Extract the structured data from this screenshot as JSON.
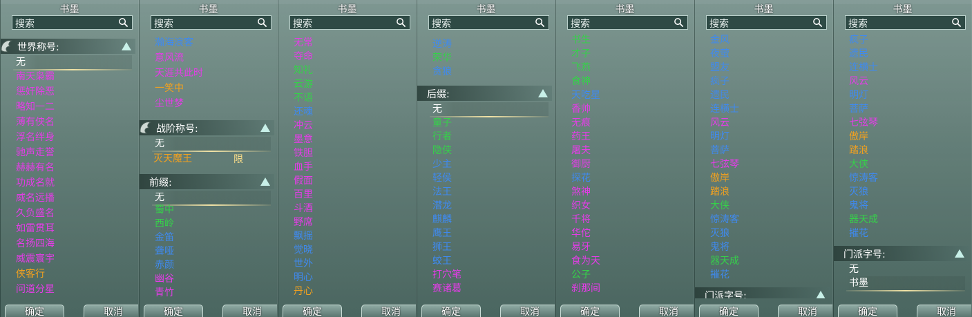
{
  "title": "书墨",
  "search_placeholder": "搜索",
  "buttons": {
    "ok": "确定",
    "cancel": "取消"
  },
  "colors": {
    "blue": "#3f8af0",
    "magenta": "#e53ce8",
    "green": "#36d04a",
    "orange": "#f0a020"
  },
  "col1": {
    "section_world": "世界称号:",
    "world_selected": "无",
    "items": [
      {
        "t": "南天枭霸",
        "c": "mag"
      },
      {
        "t": "惩奸除恶",
        "c": "mag"
      },
      {
        "t": "略知一二",
        "c": "mag"
      },
      {
        "t": "薄有侠名",
        "c": "mag"
      },
      {
        "t": "浮名绊身",
        "c": "mag"
      },
      {
        "t": "驰声走誉",
        "c": "mag"
      },
      {
        "t": "赫赫有名",
        "c": "mag"
      },
      {
        "t": "功成名就",
        "c": "mag"
      },
      {
        "t": "威名远播",
        "c": "mag"
      },
      {
        "t": "久负盛名",
        "c": "mag"
      },
      {
        "t": "如雷贯耳",
        "c": "mag"
      },
      {
        "t": "名扬四海",
        "c": "mag"
      },
      {
        "t": "威震寰宇",
        "c": "mag"
      },
      {
        "t": "侠客行",
        "c": "orange"
      },
      {
        "t": "问道分星",
        "c": "mag"
      }
    ]
  },
  "col2": {
    "top_items": [
      {
        "t": "瀚海浪客",
        "c": "blue"
      },
      {
        "t": "意风流",
        "c": "mag"
      },
      {
        "t": "天涯共此时",
        "c": "mag"
      },
      {
        "t": "一笑中",
        "c": "orange"
      },
      {
        "t": "尘世梦",
        "c": "mag"
      }
    ],
    "section_rank": "战阶称号:",
    "rank_selected": "无",
    "rank_item": "灭天魔王",
    "rank_limit": "限",
    "section_prefix": "前缀:",
    "prefix_selected": "无",
    "prefix_items": [
      {
        "t": "蜀中",
        "c": "green"
      },
      {
        "t": "西岭",
        "c": "green"
      },
      {
        "t": "金笛",
        "c": "blue"
      },
      {
        "t": "聋哑",
        "c": "blue"
      },
      {
        "t": "赤颜",
        "c": "blue"
      },
      {
        "t": "幽谷",
        "c": "mag"
      },
      {
        "t": "青竹",
        "c": "mag"
      }
    ]
  },
  "col3": {
    "items": [
      {
        "t": "无常",
        "c": "mag"
      },
      {
        "t": "夺命",
        "c": "mag"
      },
      {
        "t": "知礼",
        "c": "green"
      },
      {
        "t": "云游",
        "c": "green"
      },
      {
        "t": "不语",
        "c": "green"
      },
      {
        "t": "还魂",
        "c": "blue"
      },
      {
        "t": "冲云",
        "c": "mag"
      },
      {
        "t": "墨意",
        "c": "mag"
      },
      {
        "t": "铁胆",
        "c": "mag"
      },
      {
        "t": "血手",
        "c": "mag"
      },
      {
        "t": "假面",
        "c": "mag"
      },
      {
        "t": "百里",
        "c": "mag"
      },
      {
        "t": "斗酒",
        "c": "mag"
      },
      {
        "t": "野席",
        "c": "mag"
      },
      {
        "t": "飘摇",
        "c": "blue"
      },
      {
        "t": "觉晓",
        "c": "blue"
      },
      {
        "t": "世外",
        "c": "blue"
      },
      {
        "t": "明心",
        "c": "blue"
      },
      {
        "t": "丹心",
        "c": "orange"
      }
    ]
  },
  "col4": {
    "top_items": [
      {
        "t": "逆涛",
        "c": "blue"
      },
      {
        "t": "荣华",
        "c": "green"
      },
      {
        "t": "贪狼",
        "c": "blue"
      }
    ],
    "section_suffix": "后缀:",
    "suffix_selected": "无",
    "suffix_items": [
      {
        "t": "童子",
        "c": "green"
      },
      {
        "t": "行者",
        "c": "green"
      },
      {
        "t": "隐侠",
        "c": "green"
      },
      {
        "t": "少主",
        "c": "blue"
      },
      {
        "t": "轻侯",
        "c": "blue"
      },
      {
        "t": "法王",
        "c": "blue"
      },
      {
        "t": "潜龙",
        "c": "blue"
      },
      {
        "t": "麒麟",
        "c": "blue"
      },
      {
        "t": "鹰王",
        "c": "blue"
      },
      {
        "t": "狮王",
        "c": "blue"
      },
      {
        "t": "蛟王",
        "c": "blue"
      },
      {
        "t": "打穴笔",
        "c": "mag"
      },
      {
        "t": "赛诸葛",
        "c": "mag"
      }
    ]
  },
  "col5": {
    "items": [
      {
        "t": "书生",
        "c": "green"
      },
      {
        "t": "才子",
        "c": "green"
      },
      {
        "t": "飞燕",
        "c": "green"
      },
      {
        "t": "食神",
        "c": "green"
      },
      {
        "t": "天吃星",
        "c": "blue"
      },
      {
        "t": "香帅",
        "c": "mag"
      },
      {
        "t": "无痕",
        "c": "mag"
      },
      {
        "t": "药王",
        "c": "mag"
      },
      {
        "t": "屠夫",
        "c": "mag"
      },
      {
        "t": "御厨",
        "c": "mag"
      },
      {
        "t": "探花",
        "c": "blue"
      },
      {
        "t": "煞神",
        "c": "mag"
      },
      {
        "t": "织女",
        "c": "mag"
      },
      {
        "t": "千将",
        "c": "mag"
      },
      {
        "t": "华佗",
        "c": "mag"
      },
      {
        "t": "易牙",
        "c": "mag"
      },
      {
        "t": "食为天",
        "c": "mag"
      },
      {
        "t": "公子",
        "c": "green"
      },
      {
        "t": "刹那间",
        "c": "mag"
      }
    ]
  },
  "col6": {
    "items": [
      {
        "t": "金风",
        "c": "blue"
      },
      {
        "t": "夜萤",
        "c": "blue"
      },
      {
        "t": "盟友",
        "c": "blue"
      },
      {
        "t": "疯子",
        "c": "blue"
      },
      {
        "t": "遗民",
        "c": "blue"
      },
      {
        "t": "连横士",
        "c": "blue"
      },
      {
        "t": "风云",
        "c": "mag"
      },
      {
        "t": "明灯",
        "c": "blue"
      },
      {
        "t": "菩萨",
        "c": "blue"
      },
      {
        "t": "七弦琴",
        "c": "mag"
      },
      {
        "t": "傲岸",
        "c": "orange"
      },
      {
        "t": "踏浪",
        "c": "orange"
      },
      {
        "t": "大侠",
        "c": "green"
      },
      {
        "t": "惊涛客",
        "c": "blue"
      },
      {
        "t": "灭狼",
        "c": "blue"
      },
      {
        "t": "鬼将",
        "c": "blue"
      },
      {
        "t": "器天成",
        "c": "green"
      },
      {
        "t": "摧花",
        "c": "blue"
      }
    ],
    "section_school": "门派字号:"
  },
  "col7": {
    "items": [
      {
        "t": "疯子",
        "c": "blue"
      },
      {
        "t": "遗民",
        "c": "blue"
      },
      {
        "t": "连横士",
        "c": "blue"
      },
      {
        "t": "风云",
        "c": "mag"
      },
      {
        "t": "明灯",
        "c": "blue"
      },
      {
        "t": "菩萨",
        "c": "blue"
      },
      {
        "t": "七弦琴",
        "c": "mag"
      },
      {
        "t": "傲岸",
        "c": "orange"
      },
      {
        "t": "踏浪",
        "c": "orange"
      },
      {
        "t": "大侠",
        "c": "green"
      },
      {
        "t": "惊涛客",
        "c": "blue"
      },
      {
        "t": "灭狼",
        "c": "blue"
      },
      {
        "t": "鬼将",
        "c": "blue"
      },
      {
        "t": "器天成",
        "c": "green"
      },
      {
        "t": "摧花",
        "c": "blue"
      }
    ],
    "section_school": "门派字号:",
    "school_none": "无",
    "school_selected": "书墨"
  }
}
